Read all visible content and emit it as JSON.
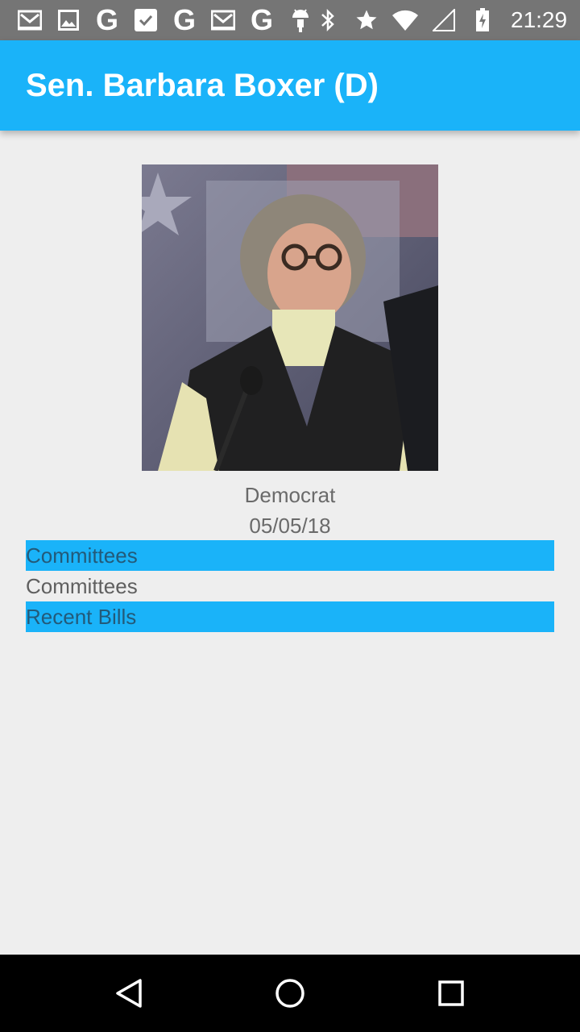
{
  "status_bar": {
    "time": "21:29",
    "left_icons": [
      "gmail-icon",
      "image-icon",
      "google-icon",
      "tasks-icon",
      "google-icon",
      "gmail-icon",
      "google-icon",
      "android-icon"
    ],
    "right_icons": [
      "bluetooth-icon",
      "star-icon",
      "wifi-icon",
      "signal-icon",
      "battery-icon"
    ]
  },
  "app_bar": {
    "title": "Sen. Barbara Boxer (D)",
    "color": "#1ab3f9"
  },
  "profile": {
    "party": "Democrat",
    "date": "05/05/18"
  },
  "sections": {
    "committees_header": "Committees",
    "committees_item": "Committees",
    "recent_bills_header": "Recent Bills"
  },
  "nav_bar": {
    "icons": [
      "back-icon",
      "home-icon",
      "recents-icon"
    ]
  }
}
